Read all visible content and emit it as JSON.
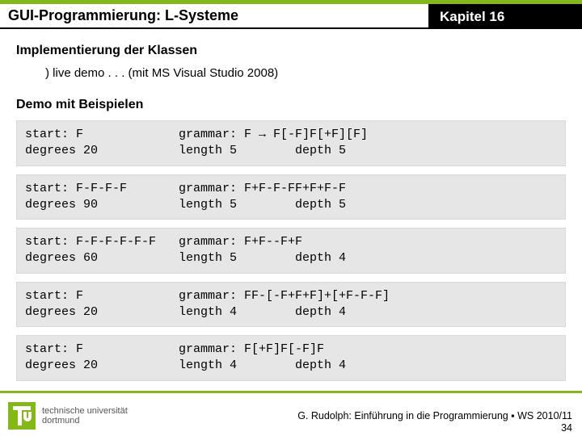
{
  "header": {
    "title": "GUI-Programmierung: L-Systeme",
    "chapter": "Kapitel 16"
  },
  "section1": {
    "heading": "Implementierung der Klassen",
    "sub": ") live demo . . . (mit MS Visual Studio 2008)"
  },
  "section2": {
    "heading": "Demo mit Beispielen"
  },
  "examples": [
    {
      "start": "start: F",
      "grammar": "grammar: F → F[-F]F[+F][F]",
      "degrees": "degrees 20",
      "length": "length 5",
      "depth": "depth 5"
    },
    {
      "start": "start: F-F-F-F",
      "grammar": "grammar: F+F-F-FF+F+F-F",
      "degrees": "degrees 90",
      "length": "length 5",
      "depth": "depth 5"
    },
    {
      "start": "start: F-F-F-F-F-F",
      "grammar": "grammar: F+F--F+F",
      "degrees": "degrees 60",
      "length": "length 5",
      "depth": "depth 4"
    },
    {
      "start": "start: F",
      "grammar": "grammar: FF-[-F+F+F]+[+F-F-F]",
      "degrees": "degrees 20",
      "length": "length 4",
      "depth": "depth 4"
    },
    {
      "start": "start: F",
      "grammar": "grammar: F[+F]F[-F]F",
      "degrees": "degrees 20",
      "length": "length 4",
      "depth": "depth 4"
    }
  ],
  "footer": {
    "uni1": "technische universität",
    "uni2": "dortmund",
    "credit": "G. Rudolph: Einführung in die Programmierung ▪ WS 2010/11",
    "page": "34"
  }
}
